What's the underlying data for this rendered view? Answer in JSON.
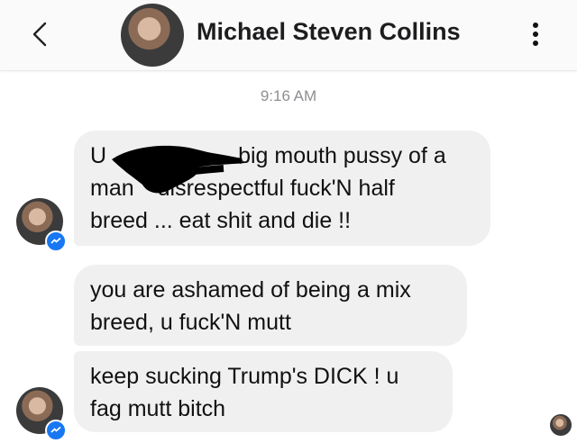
{
  "header": {
    "title": "Michael Steven Collins",
    "back_icon": "chevron-left-icon",
    "more_icon": "vertical-ellipsis-icon"
  },
  "timestamp": "9:16 AM",
  "messages": [
    {
      "lines": [
        "U",
        "big mouth pussy of a",
        "man",
        "disrespectful fuck'N half",
        "breed ... eat shit and die !!"
      ]
    },
    {
      "text": "you are ashamed of being a mix breed, u fuck'N mutt"
    },
    {
      "text": "keep sucking Trump's DICK ! u fag mutt bitch"
    }
  ],
  "colors": {
    "bubble": "#f0f0f0",
    "messenger_badge": "#1877f2",
    "timestamp": "#8e8e93"
  }
}
